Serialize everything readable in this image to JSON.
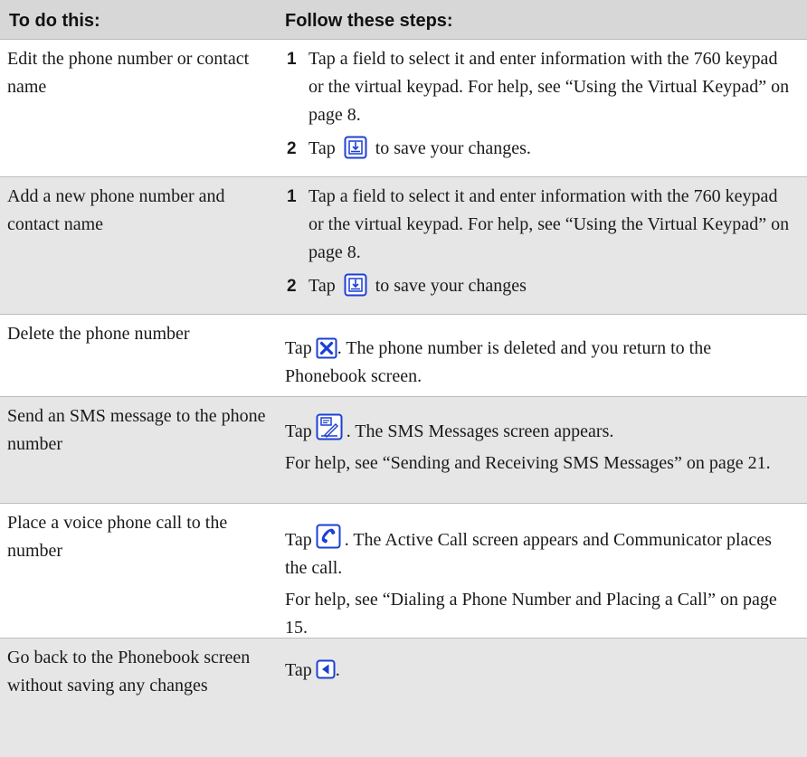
{
  "header": {
    "col1": "To do this:",
    "col2": "Follow these steps:"
  },
  "rows": [
    {
      "task": "Edit the phone number or contact name",
      "steps": [
        {
          "num": "1",
          "text": "Tap a field to select it and enter information with the 760 keypad or the virtual keypad. For help, see “Using the Virtual Keypad” on page 8."
        },
        {
          "num": "2",
          "pre": "Tap",
          "icon": "save-icon",
          "post": "to save your changes."
        }
      ]
    },
    {
      "task": "Add a new phone number and contact name",
      "steps": [
        {
          "num": "1",
          "text": "Tap a field to select it and enter information with the 760 keypad or the virtual keypad. For help, see “Using the Virtual Keypad” on page 8."
        },
        {
          "num": "2",
          "pre": "Tap",
          "icon": "save-icon",
          "post": "to save your changes"
        }
      ]
    },
    {
      "task": "Delete the phone number",
      "pre": "Tap",
      "icon": "delete-icon",
      "post": ". The phone number is deleted and you return to the Phonebook screen."
    },
    {
      "task": "Send an SMS message to the phone number",
      "pre": "Tap",
      "icon": "sms-icon",
      "post": ". The SMS Messages screen appears.",
      "extra": "For help, see “Sending and Receiving SMS Messages” on page 21."
    },
    {
      "task": "Place a voice phone call to the number",
      "pre": "Tap",
      "icon": "phone-icon",
      "post": ". The Active Call screen appears and Communicator places the call.",
      "extra": "For help, see “Dialing a Phone Number and Placing a Call” on page 15."
    },
    {
      "task": "Go back to the Phonebook screen without saving any changes",
      "pre": "Tap",
      "icon": "back-arrow-icon",
      "post": "."
    }
  ],
  "colors": {
    "header_bg": "#d7d7d7",
    "shaded_row_bg": "#e6e6e6",
    "icon_blue": "#1c3fd4"
  }
}
